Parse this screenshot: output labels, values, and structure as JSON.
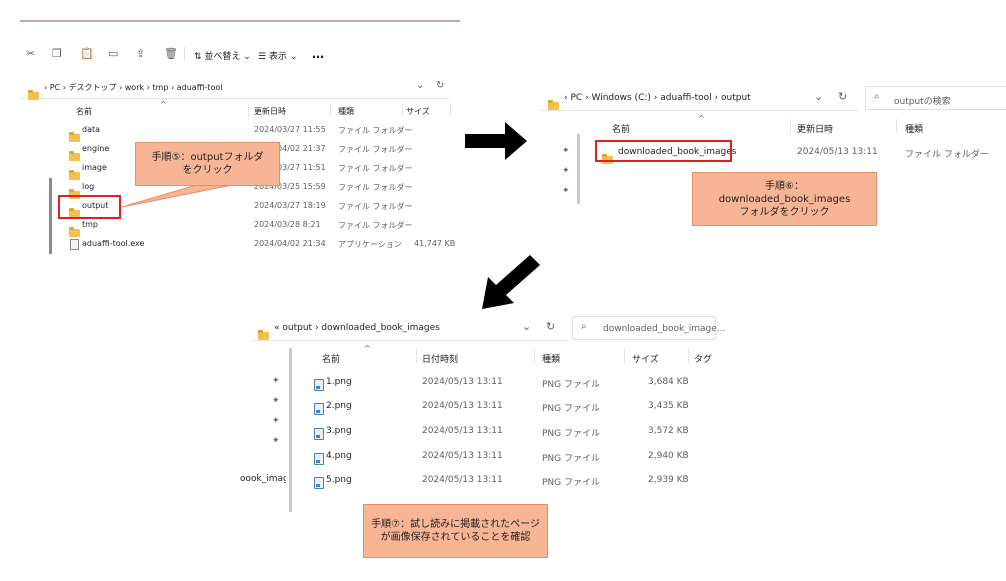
{
  "p1": {
    "toolbar": {
      "sort_label": "並べ替え",
      "view_label": "表示",
      "more_label": "…"
    },
    "breadcrumb": [
      "PC",
      "デスクトップ",
      "work",
      "tmp",
      "aduaffi-tool"
    ],
    "headers": {
      "name": "名前",
      "date": "更新日時",
      "type": "種類",
      "size": "サイズ"
    },
    "rows": [
      {
        "name": "data",
        "date": "2024/03/27 11:55",
        "type": "ファイル フォルダー",
        "size": ""
      },
      {
        "name": "engine",
        "date": "2024/04/02 21:37",
        "type": "ファイル フォルダー",
        "size": ""
      },
      {
        "name": "image",
        "date": "2024/03/27 11:51",
        "type": "ファイル フォルダー",
        "size": ""
      },
      {
        "name": "log",
        "date": "2024/03/25 15:59",
        "type": "ファイル フォルダー",
        "size": ""
      },
      {
        "name": "output",
        "date": "2024/03/27 18:19",
        "type": "ファイル フォルダー",
        "size": ""
      },
      {
        "name": "tmp",
        "date": "2024/03/28 8:21",
        "type": "ファイル フォルダー",
        "size": ""
      },
      {
        "name": "aduaffi-tool.exe",
        "date": "2024/04/02 21:34",
        "type": "アプリケーション",
        "size": "41,747 KB"
      }
    ],
    "callout_line1": "手順⑤：outputフォルダ",
    "callout_line2": "をクリック"
  },
  "p2": {
    "breadcrumb": [
      "PC",
      "Windows (C:)",
      "aduaffi-tool",
      "output"
    ],
    "search_placeholder": "outputの検索",
    "headers": {
      "name": "名前",
      "date": "更新日時",
      "type": "種類"
    },
    "row": {
      "name": "downloaded_book_images",
      "date": "2024/05/13 13:11",
      "type": "ファイル フォルダー"
    },
    "callout_line1": "手順⑥：",
    "callout_line2": "downloaded_book_images",
    "callout_line3": "フォルダをクリック"
  },
  "p3": {
    "breadcrumb_prefix": "«",
    "breadcrumb": [
      "output",
      "downloaded_book_images"
    ],
    "search_placeholder": "downloaded_book_image...",
    "headers": {
      "name": "名前",
      "date": "日付時刻",
      "type": "種類",
      "size": "サイズ",
      "tag": "タグ"
    },
    "side_label": "oook_imag",
    "rows": [
      {
        "name": "1.png",
        "date": "2024/05/13 13:11",
        "type": "PNG ファイル",
        "size": "3,684 KB"
      },
      {
        "name": "2.png",
        "date": "2024/05/13 13:11",
        "type": "PNG ファイル",
        "size": "3,435 KB"
      },
      {
        "name": "3.png",
        "date": "2024/05/13 13:11",
        "type": "PNG ファイル",
        "size": "3,572 KB"
      },
      {
        "name": "4.png",
        "date": "2024/05/13 13:11",
        "type": "PNG ファイル",
        "size": "2,940 KB"
      },
      {
        "name": "5.png",
        "date": "2024/05/13 13:11",
        "type": "PNG ファイル",
        "size": "2,939 KB"
      }
    ],
    "callout_line1": "手順⑦：試し読みに掲載されたページ",
    "callout_line2": "が画像保存されていることを確認"
  }
}
